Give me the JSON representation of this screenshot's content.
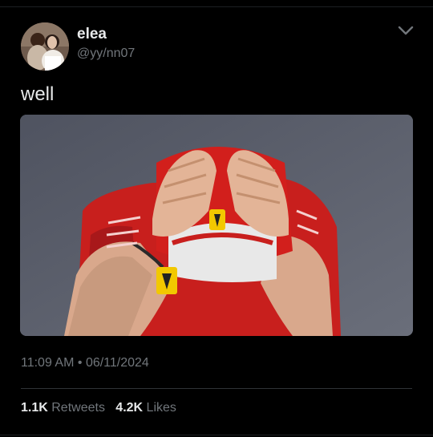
{
  "user": {
    "display_name": "elea",
    "handle": "@yy/nn07",
    "avatar_icon": "profile-photo"
  },
  "tweet": {
    "text": "well",
    "media_description_icon": "photo-driver-hands-on-cap",
    "timestamp": "11:09 AM",
    "separator": "•",
    "date": "06/11/2024"
  },
  "stats": {
    "retweets_count": "1.1K",
    "retweets_label": "Retweets",
    "likes_count": "4.2K",
    "likes_label": "Likes"
  },
  "colors": {
    "background": "#000000",
    "primary_text": "#e7e9ea",
    "secondary_text": "#71767b",
    "ferrari_red": "#d21f1c"
  }
}
